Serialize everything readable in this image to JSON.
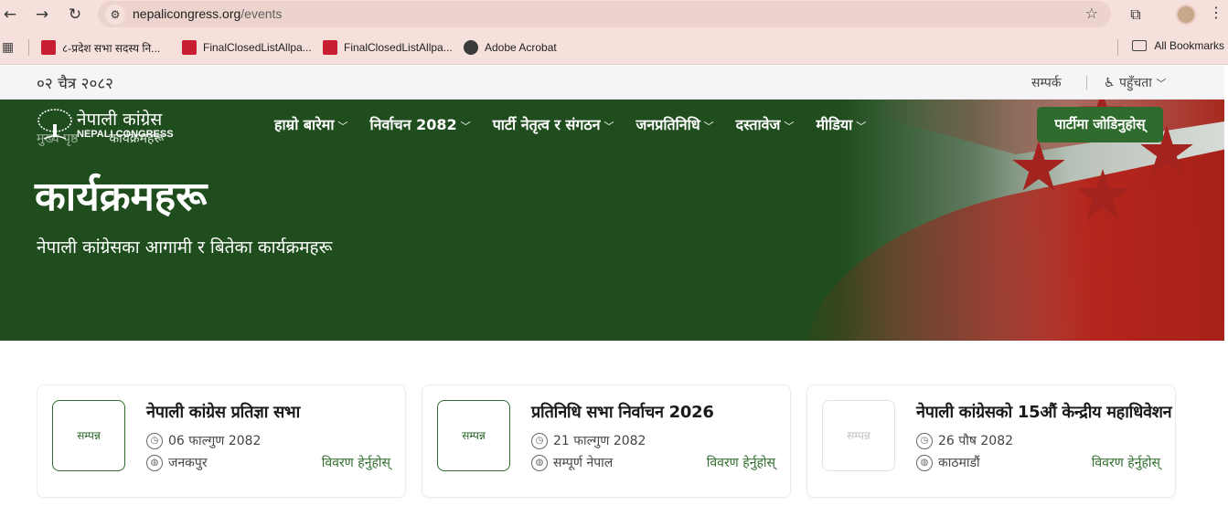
{
  "browser": {
    "url_host": "nepalicongress.org",
    "url_path": "/events",
    "bookmarks": [
      {
        "label": "८-प्रदेश सभा सदस्य नि..."
      },
      {
        "label": "FinalClosedListAllpa..."
      },
      {
        "label": "FinalClosedListAllpa..."
      },
      {
        "label": "Adobe Acrobat"
      }
    ],
    "all_bookmarks": "All Bookmarks"
  },
  "topbar": {
    "date": "०२ चैत्र २०८२",
    "contact": "सम्पर्क",
    "accessibility": "पहुँचता"
  },
  "header": {
    "logo_text": "नेपाली कांग्रेस",
    "logo_sub": "NEPALI CONGRESS",
    "breadcrumb_home": "मुख्य पृष्ठ",
    "breadcrumb_current": "कार्यक्रमहरू",
    "nav": [
      {
        "label": "हाम्रो बारेमा"
      },
      {
        "label": "निर्वाचन 2082"
      },
      {
        "label": "पार्टी नेतृत्व र संगठन"
      },
      {
        "label": "जनप्रतिनिधि"
      },
      {
        "label": "दस्तावेज"
      },
      {
        "label": "मीडिया"
      }
    ],
    "join_button": "पार्टीमा जोडिनुहोस्"
  },
  "hero": {
    "title": "कार्यक्रमहरू",
    "subtitle": "नेपाली कांग्रेसका आगामी र बितेका कार्यक्रमहरू"
  },
  "events": [
    {
      "status": "सम्पन्न",
      "title": "नेपाली कांग्रेस प्रतिज्ञा सभा",
      "date": "06 फाल्गुण 2082",
      "location": "जनकपुर",
      "link": "विवरण हेर्नुहोस्"
    },
    {
      "status": "सम्पन्न",
      "title": "प्रतिनिधि सभा निर्वाचन 2026",
      "date": "21 फाल्गुण 2082",
      "location": "सम्पूर्ण नेपाल",
      "link": "विवरण हेर्नुहोस्"
    },
    {
      "status": "सम्पन्न",
      "title": "नेपाली कांग्रेसको 15औं केन्द्रीय महाधिवेशन",
      "date": "26 पौष 2082",
      "location": "काठमाडौं",
      "link": "विवरण हेर्नुहोस्"
    }
  ],
  "colors": {
    "brand_green": "#1f4d1d",
    "button_green": "#2e6b2c",
    "flag_red": "#b4261d"
  }
}
